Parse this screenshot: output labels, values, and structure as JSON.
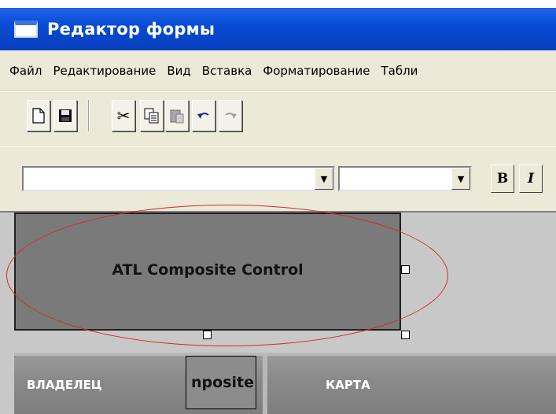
{
  "window": {
    "title": "Редактор формы"
  },
  "menu": {
    "items": [
      {
        "label": "Файл"
      },
      {
        "label": "Редактирование"
      },
      {
        "label": "Вид"
      },
      {
        "label": "Вставка"
      },
      {
        "label": "Форматирование"
      },
      {
        "label": "Табли"
      }
    ]
  },
  "toolbar": {
    "icons": [
      "new-document-icon",
      "save-icon",
      "cut-icon",
      "copy-icon",
      "paste-icon",
      "undo-icon",
      "redo-icon"
    ]
  },
  "format": {
    "font_name": "",
    "font_size": "",
    "bold_label": "B",
    "italic_label": "I"
  },
  "canvas": {
    "control_label": "ATL Composite Control",
    "header_owner": "ВЛАДЕЛЕЦ",
    "header_card": "КАРТА",
    "inner_fragment": "nposite",
    "highlight_color": "#d42a2a"
  }
}
